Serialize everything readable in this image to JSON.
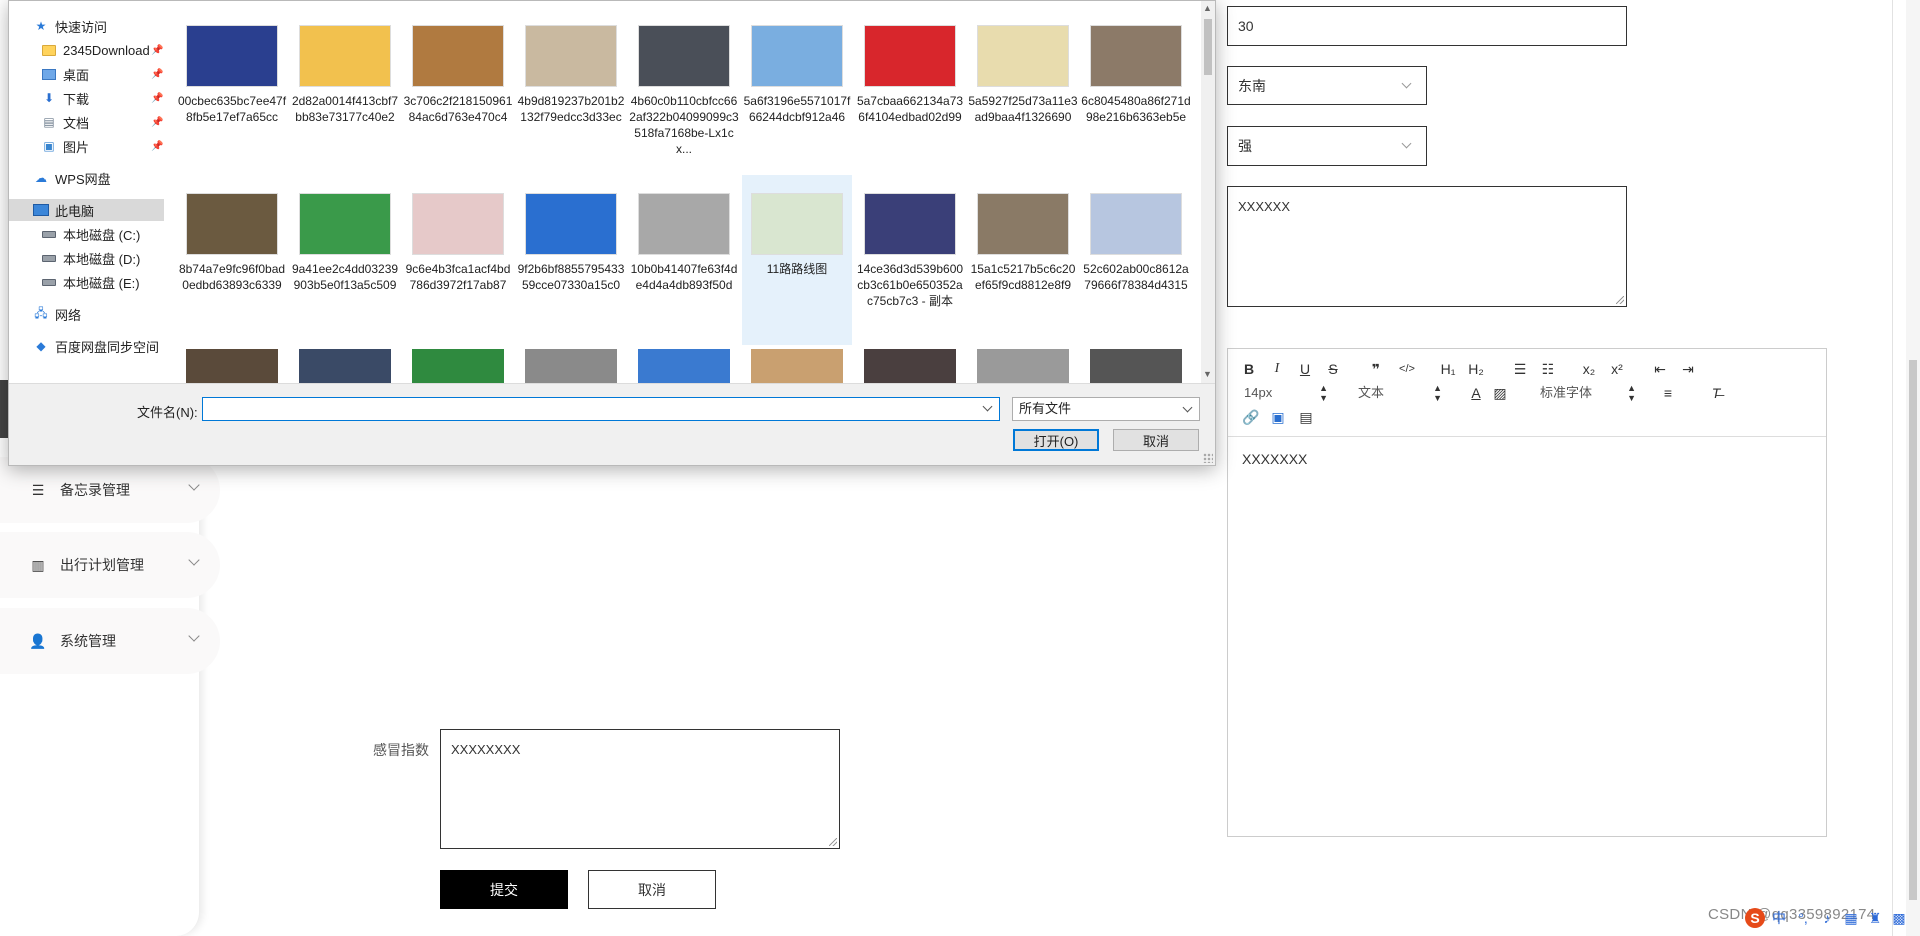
{
  "background_page": {
    "sidebar": {
      "items": [
        {
          "label": "备忘录管理",
          "icon": "list-icon"
        },
        {
          "label": "出行计划管理",
          "icon": "book-icon"
        },
        {
          "label": "系统管理",
          "icon": "user-icon"
        }
      ]
    },
    "form_left": {
      "cold_index_label": "感冒指数",
      "cold_index_value": "XXXXXXXX",
      "submit_label": "提交",
      "cancel_label": "取消"
    },
    "form_right": {
      "number_value": "30",
      "direction_value": "东南",
      "strength_value": "强",
      "textarea_value": "XXXXXX",
      "editor": {
        "font_size": "14px",
        "block_type": "文本",
        "font_family": "标准字体",
        "content": "XXXXXXX",
        "buttons": {
          "bold": "B",
          "italic": "I",
          "underline": "U",
          "strike": "S",
          "quote": "❞",
          "code": "</>",
          "h1": "H₁",
          "h2": "H₂",
          "subscript": "x₂",
          "superscript": "x²"
        }
      }
    },
    "watermark": "CSDN @qq3359892174"
  },
  "file_dialog": {
    "nav": {
      "quick_access": "快速访问",
      "items": [
        {
          "label": "2345Download",
          "pinned": true
        },
        {
          "label": "桌面",
          "pinned": true
        },
        {
          "label": "下载",
          "pinned": true
        },
        {
          "label": "文档",
          "pinned": true
        },
        {
          "label": "图片",
          "pinned": true
        }
      ],
      "wps": "WPS网盘",
      "this_pc": "此电脑",
      "drives": [
        "本地磁盘 (C:)",
        "本地磁盘 (D:)",
        "本地磁盘 (E:)"
      ],
      "network": "网络",
      "baidu": "百度网盘同步空间"
    },
    "files_row1": [
      {
        "name": "00cbec635bc7ee47f8fb5e17ef7a65cc",
        "color": "#2a3f8f"
      },
      {
        "name": "2d82a0014f413cbf7bb83e73177c40e2",
        "color": "#f2c14e"
      },
      {
        "name": "3c706c2f21815096184ac6d763e470c4",
        "color": "#b07a40"
      },
      {
        "name": "4b9d819237b201b2132f79edcc3d33ec",
        "color": "#c9b9a0"
      },
      {
        "name": "4b60c0b110cbfcc662af322b04099099c3518fa7168be-Lx1cx...",
        "color": "#4a4f58"
      },
      {
        "name": "5a6f3196e5571017f66244dcbf912a46",
        "color": "#7aaee0"
      },
      {
        "name": "5a7cbaa662134a736f4104edbad02d99",
        "color": "#d8262c"
      },
      {
        "name": "5a5927f25d73a11e3ad9baa4f1326690",
        "color": "#e8dcae"
      },
      {
        "name": "6c8045480a86f271d98e216b6363eb5e",
        "color": "#8c7a68"
      }
    ],
    "files_row2": [
      {
        "name": "8b74a7e9fc96f0bad0edbd63893c6339",
        "color": "#6b5a40"
      },
      {
        "name": "9a41ee2c4dd03239903b5e0f13a5c509",
        "color": "#3a9a4a"
      },
      {
        "name": "9c6e4b3fca1acf4bd786d3972f17ab87",
        "color": "#e6c9c9"
      },
      {
        "name": "9f2b6bf885579543359cce07330a15c0",
        "color": "#2a6fd0"
      },
      {
        "name": "10b0b41407fe63f4de4d4a4db893f50d",
        "color": "#a8a8a8"
      },
      {
        "name": "11路路线图",
        "color": "#d9e6d0"
      },
      {
        "name": "14ce36d3d539b600cb3c61b0e650352ac75cb7c3 - 副本",
        "color": "#3a3f78"
      },
      {
        "name": "15a1c5217b5c6c20ef65f9cd8812e8f9",
        "color": "#8a7a66"
      },
      {
        "name": "52c602ab00c8612a79666f78384d4315",
        "color": "#b7c6e0"
      }
    ],
    "files_row3_colors": [
      "#5a4a3a",
      "#3a4a66",
      "#2f8a3f",
      "#8a8a8a",
      "#3a7ad0",
      "#c9a070",
      "#4a3f3f",
      "#9a9a9a",
      "#555555"
    ],
    "filename_label": "文件名(N):",
    "filename_value": "",
    "filter_label": "所有文件",
    "open_label": "打开(O)",
    "cancel_label": "取消"
  }
}
